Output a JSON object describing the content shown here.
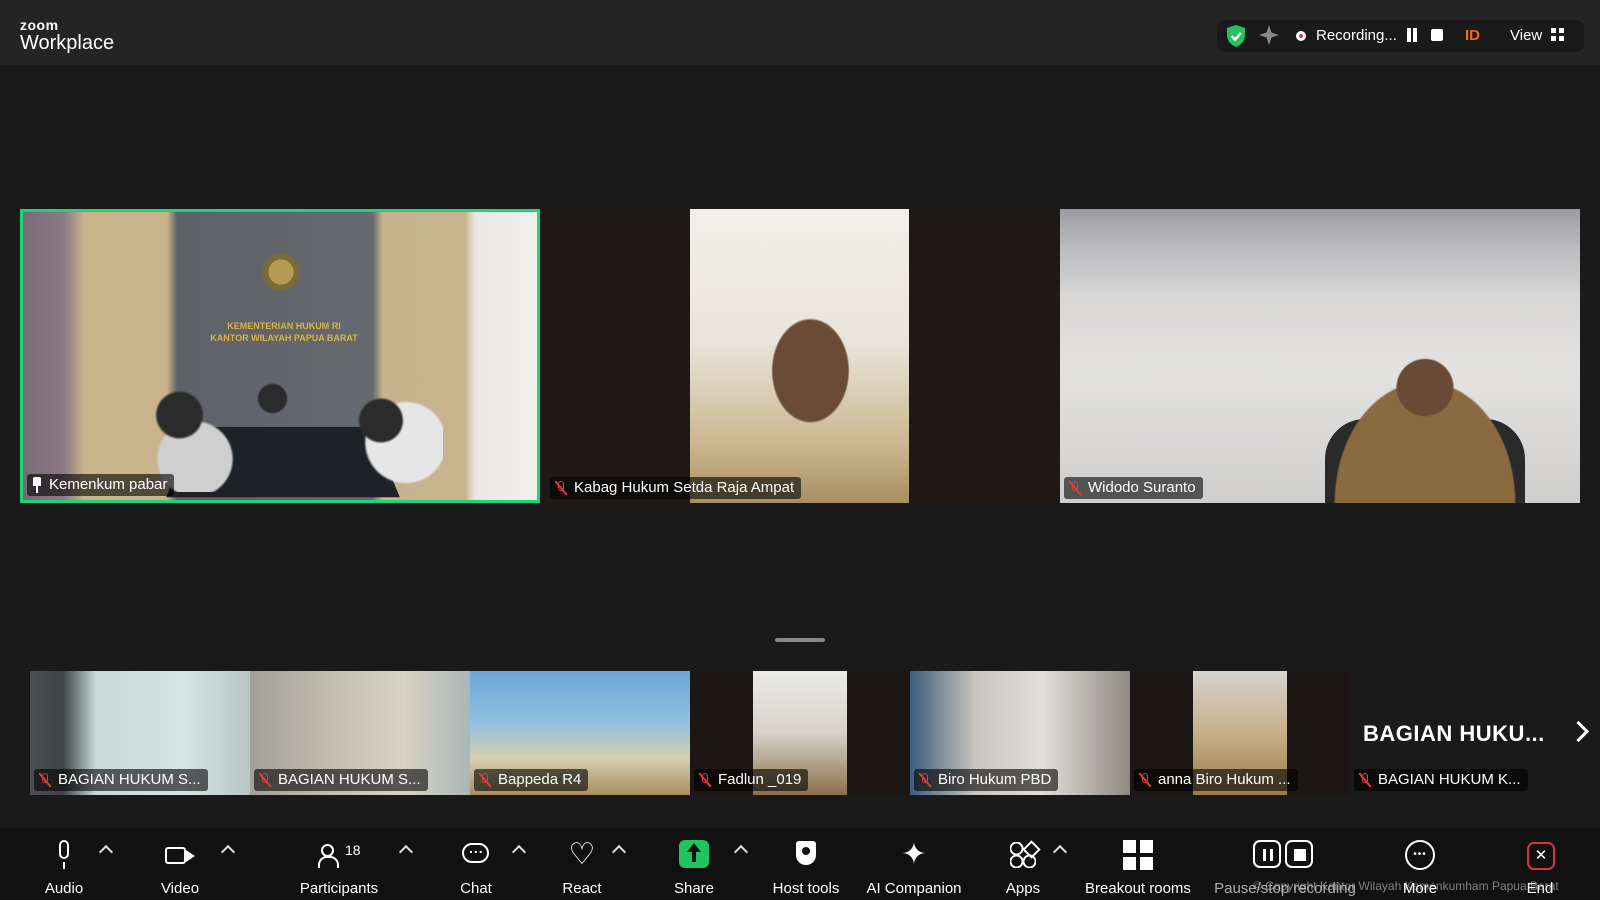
{
  "app": {
    "brand_small": "zoom",
    "brand_large": "Workplace"
  },
  "status_bar": {
    "recording_label": "Recording...",
    "id_badge": "ID",
    "view_label": "View"
  },
  "main_tiles": [
    {
      "name": "Kemenkum pabar",
      "pinned": true,
      "active_speaker": true,
      "sign_line1": "KEMENTERIAN HUKUM RI",
      "sign_line2": "KANTOR WILAYAH PAPUA BARAT"
    },
    {
      "name": "Kabag Hukum Setda Raja Ampat",
      "muted": true
    },
    {
      "name": "Widodo Suranto",
      "muted": true
    }
  ],
  "filmstrip": [
    {
      "name": "BAGIAN HUKUM S...",
      "muted": true
    },
    {
      "name": "BAGIAN HUKUM S...",
      "muted": true
    },
    {
      "name": "Bappeda R4",
      "muted": true
    },
    {
      "name": "Fadlun _019",
      "muted": true
    },
    {
      "name": "Biro Hukum PBD",
      "muted": true
    },
    {
      "name": "anna Biro Hukum ...",
      "muted": true
    },
    {
      "name": "BAGIAN HUKUM K...",
      "muted": true,
      "large_label": "BAGIAN HUKU..."
    }
  ],
  "toolbar": {
    "audio": "Audio",
    "video": "Video",
    "participants": "Participants",
    "participants_count": "18",
    "chat": "Chat",
    "react": "React",
    "share": "Share",
    "host_tools": "Host tools",
    "ai_companion": "AI Companion",
    "apps": "Apps",
    "breakout_rooms": "Breakout rooms",
    "pause_stop": "Pause/stop recording",
    "more": "More",
    "end": "End"
  },
  "watermark": "© Copyright Kantor Wilayah Kemenkumham Papua Barat",
  "colors": {
    "accent_green": "#1fd37a",
    "share_green": "#1fc460",
    "muted_red": "#e23b3b",
    "end_red": "#d8324a",
    "id_orange": "#f06b1d"
  }
}
